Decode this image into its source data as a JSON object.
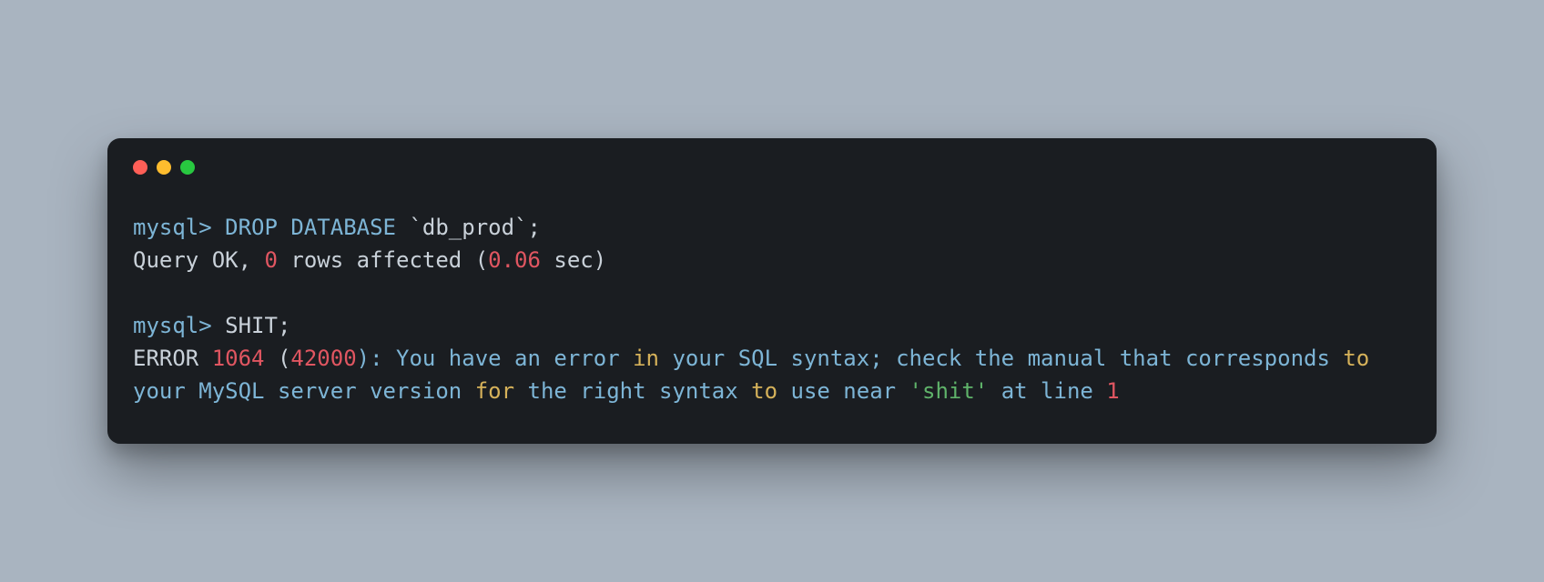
{
  "colors": {
    "bg": "#a9b4c0",
    "terminal_bg": "#1a1d21",
    "dot_red": "#ff5f57",
    "dot_yellow": "#febc2e",
    "dot_green": "#28c840",
    "prompt": "#7db5d6",
    "keyword_yellow": "#d6b25a",
    "number_red": "#e05661",
    "string_green": "#5fb36a",
    "default_text": "#c9d1d9"
  },
  "term": {
    "prompt1": "mysql> ",
    "drop_kw": "DROP",
    "space1": " ",
    "database_kw": "DATABASE",
    "space2": " ",
    "backtick1": "`",
    "dbname": "db_prod",
    "backtick2": "`",
    "semi1": ";",
    "resp1_a": "Query OK, ",
    "resp1_zero": "0",
    "resp1_b": " rows affected (",
    "resp1_time": "0.06",
    "resp1_c": " sec)",
    "blank": "",
    "prompt2": "mysql> ",
    "cmd2": "SHIT",
    "semi2": ";",
    "err_a": "ERROR ",
    "err_code1": "1064",
    "err_b": " (",
    "err_code2": "42000",
    "err_c": "): You have an error ",
    "err_in": "in",
    "err_d": " your SQL syntax; check the manual that corresponds ",
    "err_to1": "to",
    "err_e": " your MySQL server version ",
    "err_for": "for",
    "err_f": " the right syntax ",
    "err_to2": "to",
    "err_g": " use near ",
    "err_str": "'shit'",
    "err_h": " at line ",
    "err_line": "1"
  }
}
